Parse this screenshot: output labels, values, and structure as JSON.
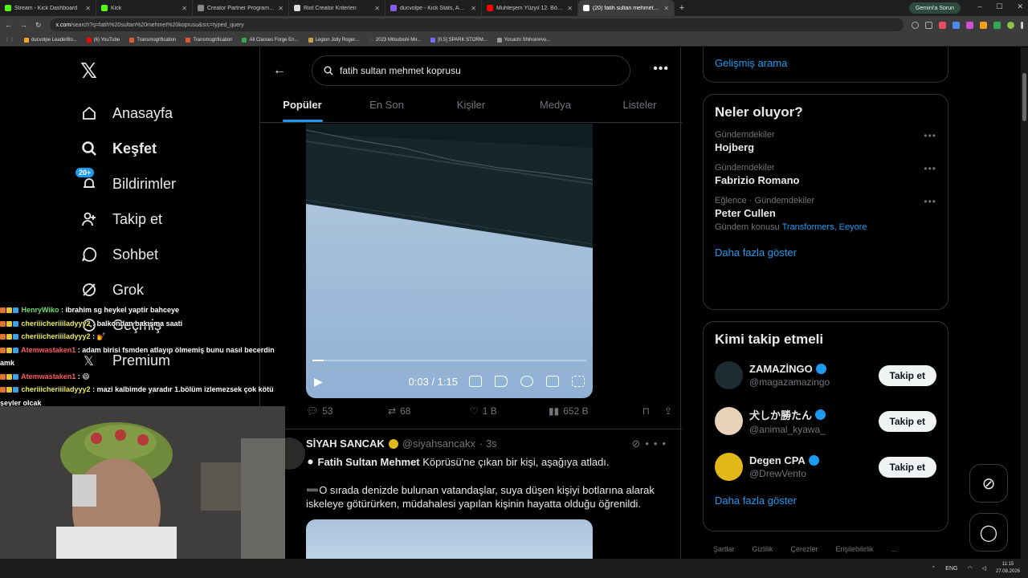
{
  "browser": {
    "tabs": [
      {
        "title": "Stream - Kick Dashboard",
        "color": "#53fc18"
      },
      {
        "title": "Kick",
        "color": "#53fc18"
      },
      {
        "title": "Creator Partner Program - Quai",
        "color": "#888888"
      },
      {
        "title": "Riot Creator Kriterleri",
        "color": "#dddddd"
      },
      {
        "title": "ducvolpe - Kick Stats, Analytic",
        "color": "#8a5cf6"
      },
      {
        "title": "Muhteşem Yüzyıl 12. Bölüm (4",
        "color": "#ff0000"
      },
      {
        "title": "(20) fatih sultan mehmet kopru",
        "color": "#ffffff"
      }
    ],
    "gemini_label": "Gemini'a Sorun",
    "url_host": "x.com",
    "url_path": "/search?q=fatih%20sultan%20mehmet%20koprusu&src=typed_query",
    "bookmarks": [
      {
        "label": "ducvolpe LeaderBo...",
        "color": "#f5a623"
      },
      {
        "label": "(6) YouTube",
        "color": "#ff0000"
      },
      {
        "label": "Transmogrification",
        "color": "#e05a2b"
      },
      {
        "label": "Transmogrification",
        "color": "#e05a2b"
      },
      {
        "label": "All Classes Forge En...",
        "color": "#34a853"
      },
      {
        "label": "Legion Jolly Roger...",
        "color": "#c8a24a"
      },
      {
        "label": "2023 Mitsubishi Mir...",
        "color": "#444444"
      },
      {
        "label": "[0.5] SPARK STORM...",
        "color": "#7a6cf0"
      },
      {
        "label": "Yoruichi Shihoin#vo...",
        "color": "#999999"
      }
    ]
  },
  "nav": {
    "items": [
      {
        "label": "Anasayfa",
        "icon": "home-icon"
      },
      {
        "label": "Keşfet",
        "icon": "search-icon"
      },
      {
        "label": "Bildirimler",
        "icon": "bell-icon",
        "badge": "20+"
      },
      {
        "label": "Takip et",
        "icon": "add-user-icon"
      },
      {
        "label": "Sohbet",
        "icon": "chat-icon"
      },
      {
        "label": "Grok",
        "icon": "grok-icon"
      },
      {
        "label": "Geçmiş",
        "icon": "history-icon"
      },
      {
        "label": "Premium",
        "icon": "premium-icon"
      }
    ]
  },
  "search": {
    "query": "fatih sultan mehmet koprusu"
  },
  "tabs": [
    "Popüler",
    "En Son",
    "Kişiler",
    "Medya",
    "Listeler"
  ],
  "video": {
    "time": "0:03 / 1:15",
    "progress": 0.04
  },
  "tweet1_actions": {
    "replies": "53",
    "retweets": "68",
    "likes": "1 B",
    "views": "652 B"
  },
  "tweet2": {
    "name": "SİYAH SANCAK",
    "handle": "@siyahsancakx",
    "time": "· 3s",
    "bold": "Fatih Sultan Mehmet",
    "line1": " Köprüsü'ne çıkan bir kişi, aşağıya atladı.",
    "line2": "O sırada denizde bulunan vatandaşlar, suya düşen kişiyi botlarına alarak iskeleye götürürken, müdahalesi yapılan kişinin hayatta olduğu öğrenildi."
  },
  "right": {
    "advanced": "Gelişmiş arama",
    "trends_title": "Neler oluyor?",
    "trends": [
      {
        "meta": "Gündemdekiler",
        "title": "Hojberg"
      },
      {
        "meta": "Gündemdekiler",
        "title": "Fabrizio Romano"
      },
      {
        "meta": "Eğlence · Gündemdekiler",
        "title": "Peter Cullen",
        "sub_prefix": "Gündem konusu",
        "sub_link": "Transformers, Eeyore"
      }
    ],
    "trends_more": "Daha fazla göster",
    "who_title": "Kimi takip etmeli",
    "who": [
      {
        "name": "ZAMAZİNGO",
        "handle": "@magazamazingo",
        "button": "Takip et",
        "color": "#1e2b30"
      },
      {
        "name": "犬しか勝たん",
        "handle": "@animal_kyawa_",
        "button": "Takip et",
        "color": "#e8d3b8"
      },
      {
        "name": "Degen CPA",
        "handle": "@DrewVento",
        "button": "Takip et",
        "color": "#e2b719"
      }
    ],
    "who_more": "Daha fazla göster",
    "footer": [
      "Şartlar",
      "Gizlilik",
      "Çerezler",
      "Erişilebilirlik",
      "..."
    ]
  },
  "chat": [
    {
      "user": "HenryWiko",
      "color": "#6fdc6f",
      "msg": " : ibrahim sg heykel yaptir bahceye"
    },
    {
      "user": "cheriiicheriiiladyyy2",
      "color": "#e8e85a",
      "msg": " : balkondan bakışma saati"
    },
    {
      "user": "cheriiicheriiiladyyy2",
      "color": "#e8e85a",
      "msg": " : 💅"
    },
    {
      "user": "Atemwastaken1",
      "color": "#ff5a5a",
      "msg": " : adam birisi fsmden atlayıp ölmemiş bunu nasıl becerdin amk"
    },
    {
      "user": "Atemwastaken1",
      "color": "#ff5a5a",
      "msg": " : 😄"
    },
    {
      "user": "cheriiicheriiiladyyy2",
      "color": "#e8e85a",
      "msg": " : mazi kalbimde yaradır 1.bölüm izlemezsek çok kötü şeyler olcak"
    }
  ],
  "taskbar": {
    "lang": "ENG",
    "time": "11:15",
    "date": "27.08.2026"
  }
}
